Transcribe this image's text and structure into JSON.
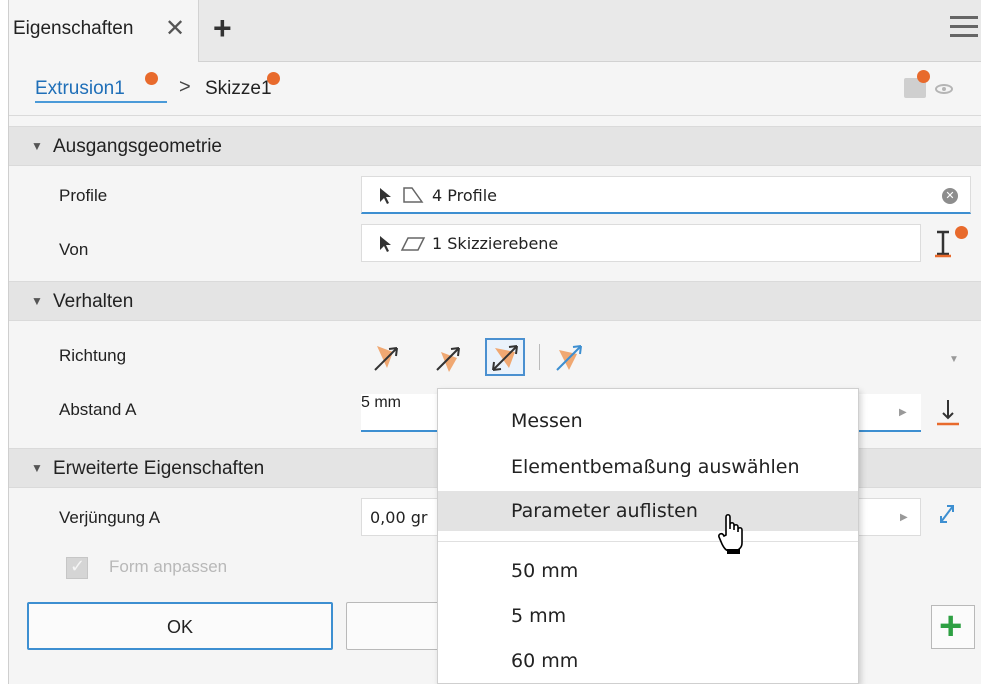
{
  "tab": {
    "label": "Eigenschaften",
    "close": "✕",
    "add": "+"
  },
  "breadcrumb": {
    "item1": "Extrusion1",
    "separator": ">",
    "item2": "Skizze1"
  },
  "sections": {
    "ausgang": "Ausgangsgeometrie",
    "verhalten": "Verhalten",
    "erweitert": "Erweiterte Eigenschaften"
  },
  "fields": {
    "profile_label": "Profile",
    "profile_value": "4 Profile",
    "von_label": "Von",
    "von_value": "1 Skizzierebene",
    "richtung_label": "Richtung",
    "abstand_label": "Abstand A",
    "abstand_value": "5 mm",
    "verjuengung_label": "Verjüngung A",
    "verjuengung_value": "0,00 gr"
  },
  "checkbox": {
    "label": "Form anpassen",
    "checked": true
  },
  "buttons": {
    "ok": "OK"
  },
  "popup": {
    "items": [
      "Messen",
      "Elementbemaßung auswählen",
      "Parameter auflisten"
    ],
    "values": [
      "50 mm",
      "5 mm",
      "60 mm"
    ],
    "hovered": "Parameter auflisten"
  },
  "colors": {
    "accent": "#3d8fd1",
    "orange": "#e86a2c",
    "green": "#2ea043",
    "link": "#1f6fb8"
  },
  "icons": [
    "close-icon",
    "add-icon",
    "menu-icon",
    "select-arrow-icon",
    "profile-icon",
    "plane-icon",
    "clear-icon",
    "flip-icon",
    "direction-icon",
    "measure-icon",
    "taper-icon",
    "hand-cursor-icon",
    "plus-icon"
  ]
}
